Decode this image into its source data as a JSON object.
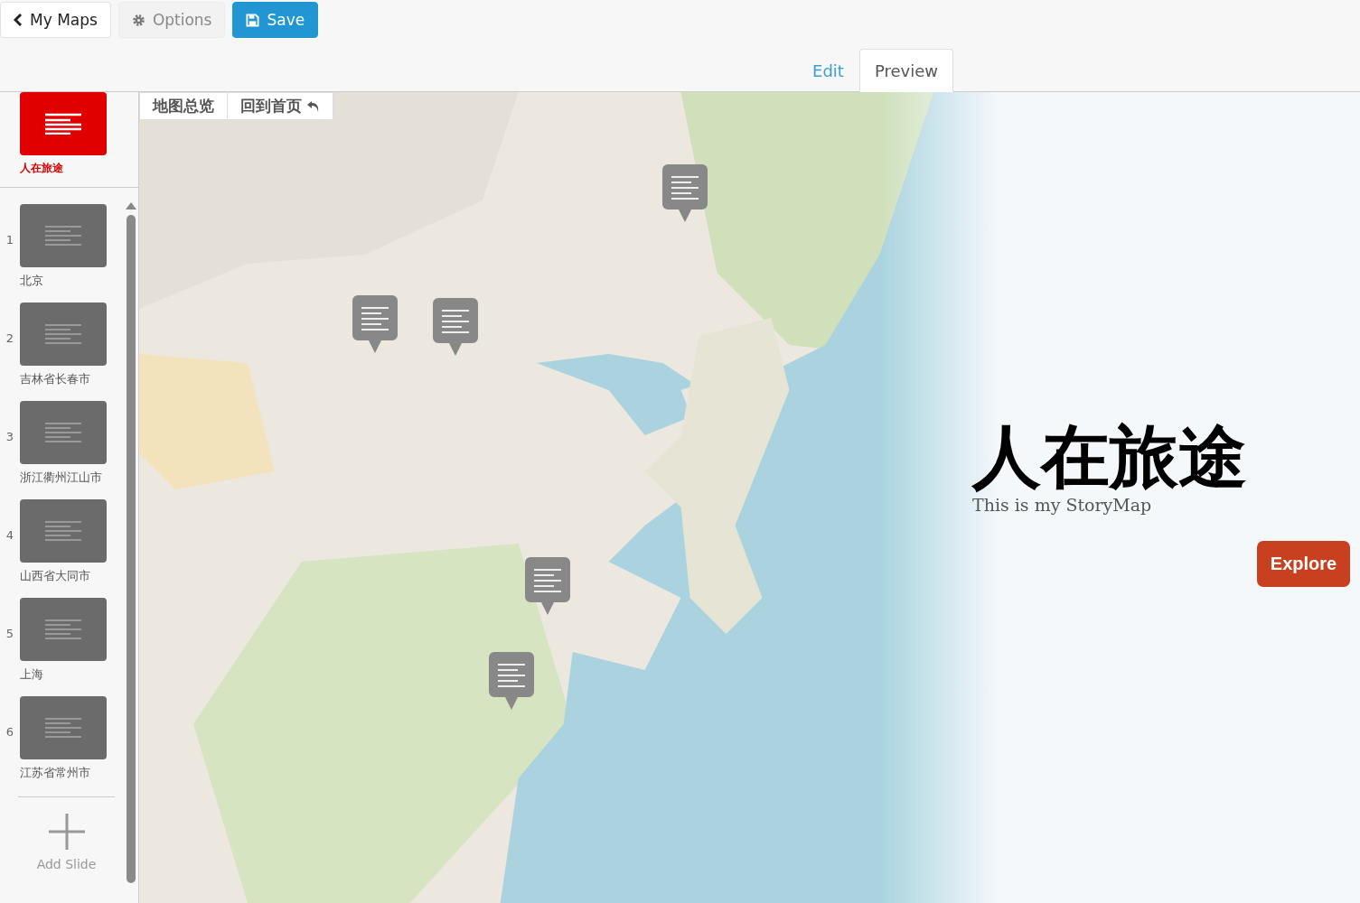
{
  "toolbar": {
    "back": "My Maps",
    "options": "Options",
    "save": "Save"
  },
  "tabs": [
    {
      "label": "Edit",
      "selected": false
    },
    {
      "label": "Preview",
      "selected": true
    }
  ],
  "cover": {
    "title": "人在旅途",
    "selected": true
  },
  "slides": [
    {
      "number": "1",
      "title": "北京",
      "selected": false
    },
    {
      "number": "2",
      "title": "吉林省长春市",
      "selected": false
    },
    {
      "number": "3",
      "title": "浙江衢州江山市",
      "selected": false
    },
    {
      "number": "4",
      "title": "山西省大同市",
      "selected": false
    },
    {
      "number": "5",
      "title": "上海",
      "selected": false
    },
    {
      "number": "6",
      "title": "江苏省常州市",
      "selected": false
    }
  ],
  "add_slide": "Add Slide",
  "map_nav": {
    "overview": "地图总览",
    "home": "回到首页"
  },
  "story": {
    "title": "人在旅途",
    "subtitle": "This is my StoryMap",
    "button": "Explore"
  }
}
